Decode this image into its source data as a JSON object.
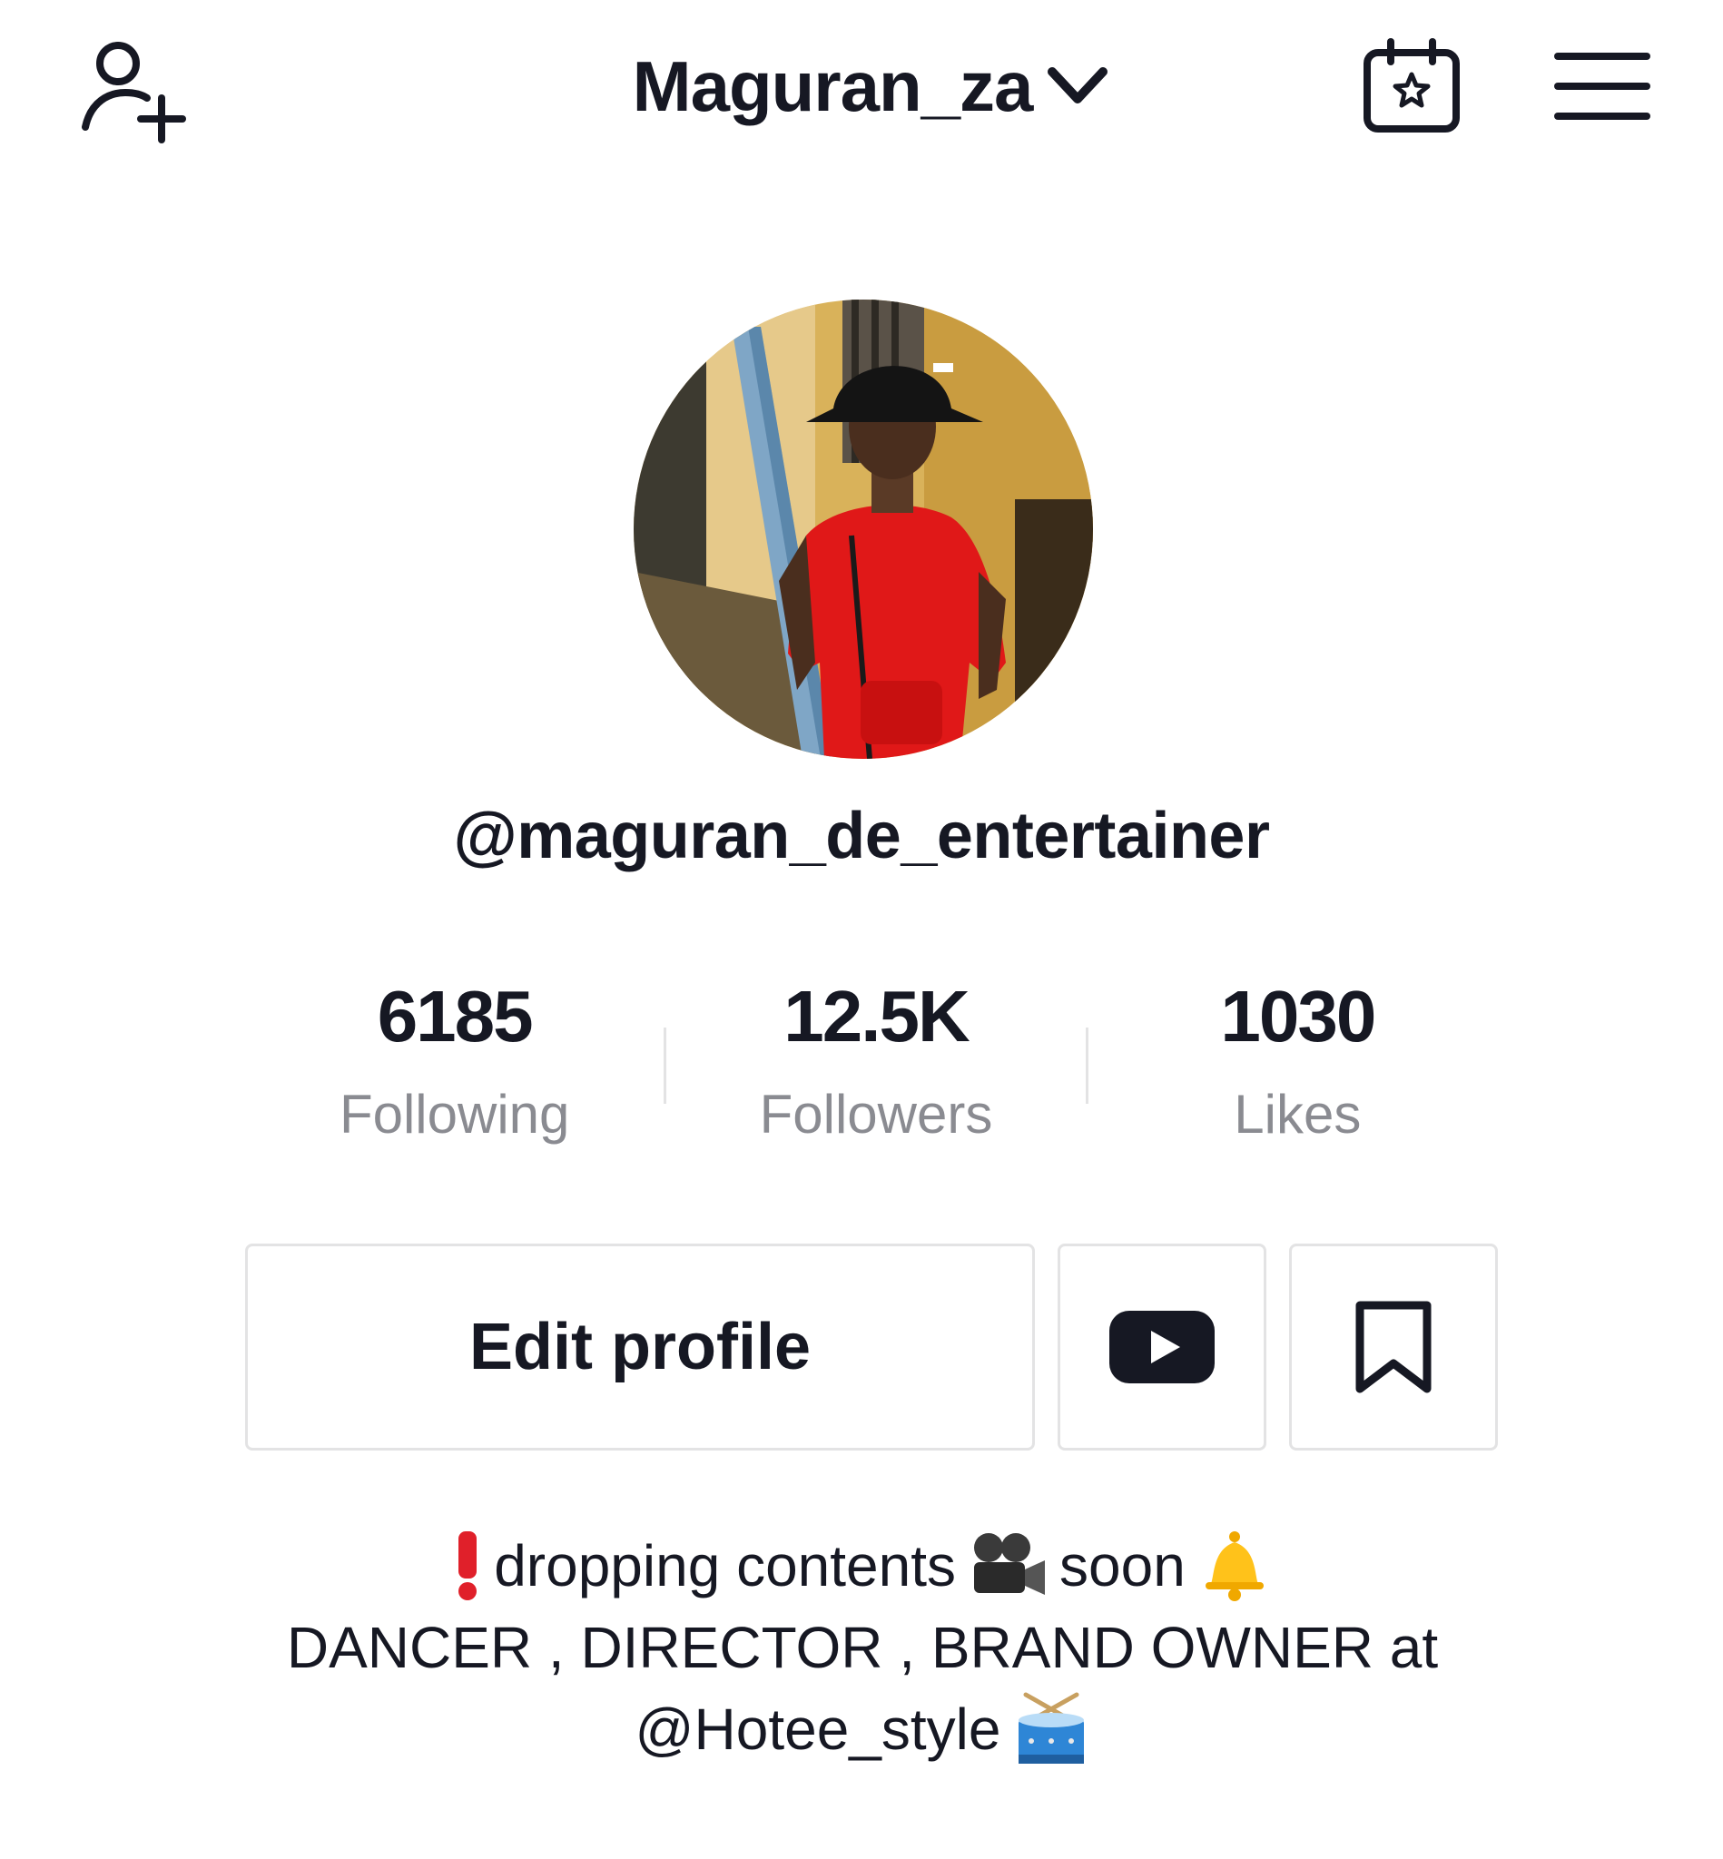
{
  "header": {
    "account_name": "Maguran_za",
    "icons": {
      "add_friend": "add-friend-icon",
      "dropdown": "chevron-down-icon",
      "calendar": "calendar-star-icon",
      "menu": "hamburger-menu-icon"
    }
  },
  "profile": {
    "avatar": "profile-avatar",
    "handle": "@maguran_de_entertainer"
  },
  "stats": [
    {
      "value": "6185",
      "label": "Following"
    },
    {
      "value": "12.5K",
      "label": "Followers"
    },
    {
      "value": "1030",
      "label": "Likes"
    }
  ],
  "actions": {
    "edit_profile_label": "Edit profile",
    "youtube_icon": "youtube-icon",
    "bookmark_icon": "bookmark-icon"
  },
  "bio": {
    "line1_a": "dropping contents",
    "line1_b": "soon",
    "line2": "DANCER , DIRECTOR , BRAND OWNER at",
    "line3": "@Hotee_style"
  },
  "colors": {
    "text_primary": "#161823",
    "text_secondary": "#8a8b91",
    "border": "#e3e3e4",
    "accent_red": "#fe2c55"
  }
}
